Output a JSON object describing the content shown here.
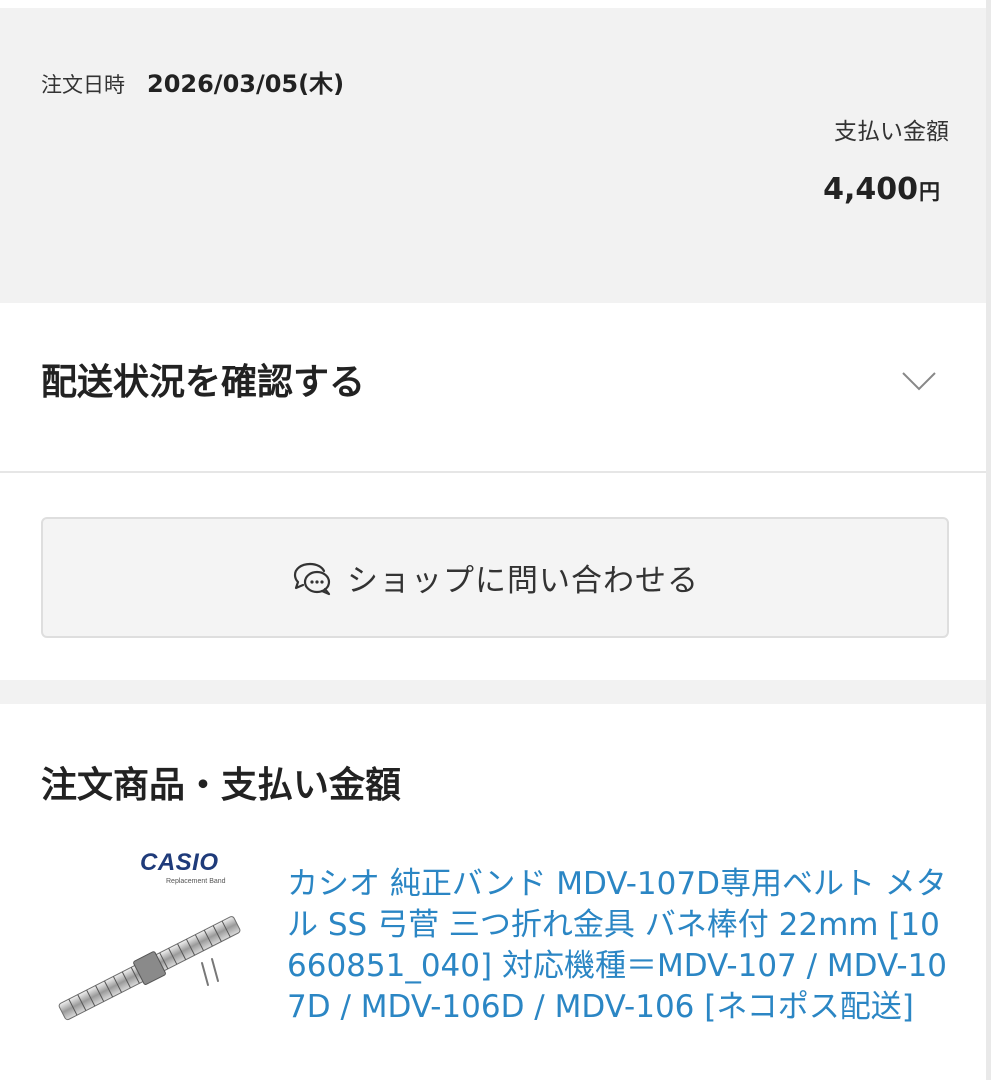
{
  "summary": {
    "order_date_label": "注文日時",
    "order_date_value": "2026/03/05(木)",
    "payment_label": "支払い金額",
    "payment_value": "4,400",
    "payment_unit": "円"
  },
  "shipping": {
    "title": "配送状況を確認する",
    "chevron_icon": "chevron-down-icon"
  },
  "contact": {
    "label": "ショップに問い合わせる",
    "icon": "chat-bubbles-icon"
  },
  "products": {
    "title": "注文商品・支払い金額",
    "items": [
      {
        "thumb_brand": "CASIO",
        "thumb_subtitle": "Replacement Band",
        "name": "カシオ 純正バンド MDV-107D専用ベルト メタル SS 弓菅 三つ折れ金具 バネ棒付 22mm [10660851_040] 対応機種＝MDV-107 / MDV-107D / MDV-106D / MDV-106 [ネコポス配送]"
      }
    ]
  },
  "colors": {
    "link": "#2b86c4",
    "background_gray": "#f2f2f2",
    "text": "#222222"
  }
}
